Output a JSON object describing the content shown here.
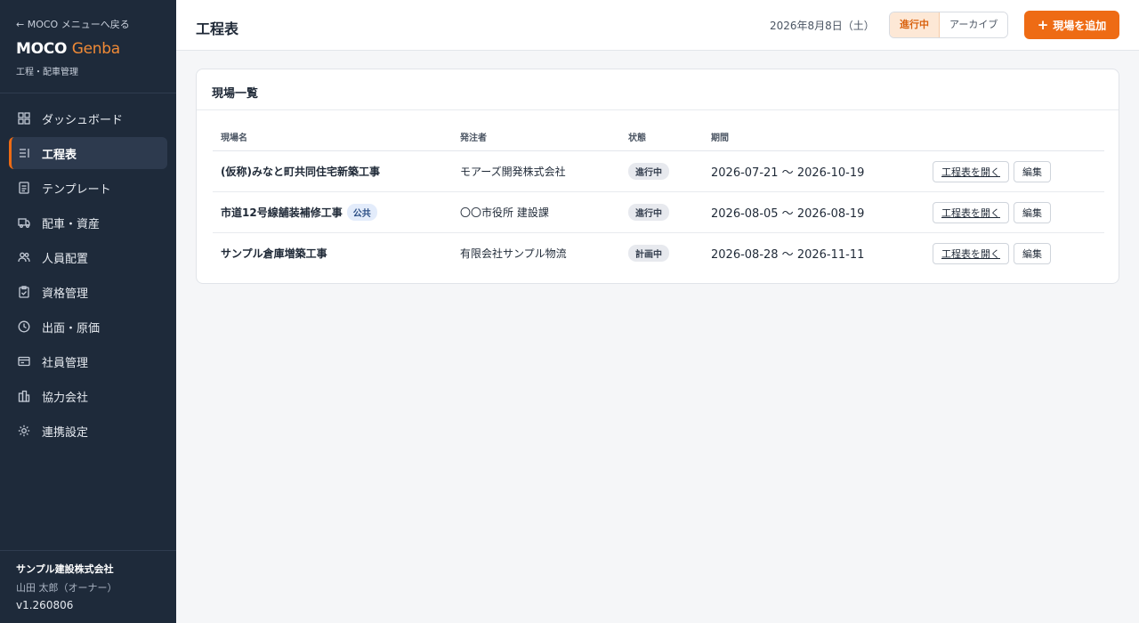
{
  "sidebar": {
    "back_label": "← MOCO メニューへ戻る",
    "brand_main": "MOCO",
    "brand_accent": "Genba",
    "brand_sub": "工程・配車管理",
    "items": [
      {
        "label": "ダッシュボード",
        "icon": "dashboard-icon"
      },
      {
        "label": "工程表",
        "icon": "schedule-icon",
        "active": true
      },
      {
        "label": "テンプレート",
        "icon": "document-icon"
      },
      {
        "label": "配車・資産",
        "icon": "truck-icon"
      },
      {
        "label": "人員配置",
        "icon": "users-icon"
      },
      {
        "label": "資格管理",
        "icon": "clipboard-icon"
      },
      {
        "label": "出面・原価",
        "icon": "clock-icon"
      },
      {
        "label": "社員管理",
        "icon": "id-card-icon"
      },
      {
        "label": "協力会社",
        "icon": "building-icon"
      },
      {
        "label": "連携設定",
        "icon": "sun-icon"
      }
    ],
    "company": "サンプル建設株式会社",
    "user": "山田 太郎（オーナー）",
    "version": "v1.260806"
  },
  "header": {
    "title": "工程表",
    "date": "2026年8月8日（土）",
    "filter_active": "進行中",
    "filter_archive": "アーカイブ",
    "add_plus": "+",
    "add_label": "現場を追加"
  },
  "card": {
    "title": "現場一覧",
    "columns": [
      "現場名",
      "発注者",
      "状態",
      "期間"
    ],
    "rows": [
      {
        "name": "(仮称)みなと町共同住宅新築工事",
        "tag": "",
        "client": "モアーズ開発株式会社",
        "status": "進行中",
        "period": "2026-07-21 〜 2026-10-19",
        "open_label": "工程表を開く",
        "edit_label": "編集"
      },
      {
        "name": "市道12号線舗装補修工事",
        "tag": "公共",
        "client": "〇〇市役所 建設課",
        "status": "進行中",
        "period": "2026-08-05 〜 2026-08-19",
        "open_label": "工程表を開く",
        "edit_label": "編集"
      },
      {
        "name": "サンプル倉庫増築工事",
        "tag": "",
        "client": "有限会社サンプル物流",
        "status": "計画中",
        "period": "2026-08-28 〜 2026-11-11",
        "open_label": "工程表を開く",
        "edit_label": "編集"
      }
    ]
  },
  "colors": {
    "sidebar_bg": "#1e2a3a",
    "accent": "#ee6b14",
    "brand_accent": "#f08a36"
  }
}
